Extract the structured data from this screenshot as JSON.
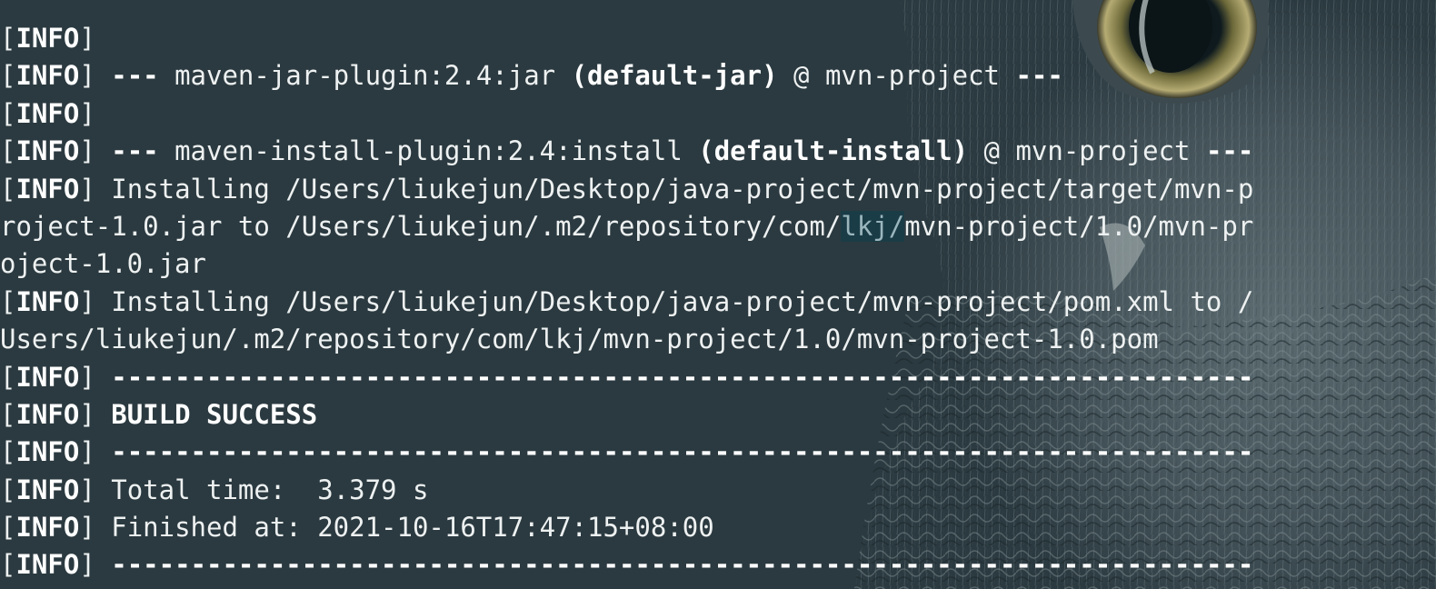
{
  "colors": {
    "background": "#2b3a40",
    "text": "#eef1f1",
    "bold_text": "#ffffff",
    "selection": "#1a3c47"
  },
  "background_image": "owl-wallpaper",
  "lines": [
    {
      "parts": [
        {
          "t": "[",
          "b": false
        },
        {
          "t": "INFO",
          "b": true
        },
        {
          "t": "]",
          "b": false
        }
      ]
    },
    {
      "parts": [
        {
          "t": "[",
          "b": false
        },
        {
          "t": "INFO",
          "b": true
        },
        {
          "t": "] ",
          "b": false
        },
        {
          "t": "---",
          "b": true
        },
        {
          "t": " maven-jar-plugin:2.4:jar ",
          "b": false
        },
        {
          "t": "(default-jar)",
          "b": true
        },
        {
          "t": " @ mvn-project ",
          "b": false
        },
        {
          "t": "---",
          "b": true
        }
      ]
    },
    {
      "parts": [
        {
          "t": "[",
          "b": false
        },
        {
          "t": "INFO",
          "b": true
        },
        {
          "t": "]",
          "b": false
        }
      ]
    },
    {
      "parts": [
        {
          "t": "[",
          "b": false
        },
        {
          "t": "INFO",
          "b": true
        },
        {
          "t": "] ",
          "b": false
        },
        {
          "t": "---",
          "b": true
        },
        {
          "t": " maven-install-plugin:2.4:install ",
          "b": false
        },
        {
          "t": "(default-install)",
          "b": true
        },
        {
          "t": " @ mvn-project ",
          "b": false
        },
        {
          "t": "---",
          "b": true
        }
      ]
    },
    {
      "parts": [
        {
          "t": "[",
          "b": false
        },
        {
          "t": "INFO",
          "b": true
        },
        {
          "t": "] Installing /Users/liukejun/Desktop/java-project/mvn-project/target/mvn-p",
          "b": false
        }
      ]
    },
    {
      "parts": [
        {
          "t": "roject-1.0.jar to /Users/liukejun/.m2/repository/com/",
          "b": false
        },
        {
          "t": "lkj/",
          "b": false,
          "hl": true
        },
        {
          "t": "mvn-project/1.0/mvn-pr",
          "b": false
        }
      ]
    },
    {
      "parts": [
        {
          "t": "oject-1.0.jar",
          "b": false
        }
      ]
    },
    {
      "parts": [
        {
          "t": "[",
          "b": false
        },
        {
          "t": "INFO",
          "b": true
        },
        {
          "t": "] Installing /Users/liukejun/Desktop/java-project/mvn-project/pom.xml to /",
          "b": false
        }
      ]
    },
    {
      "parts": [
        {
          "t": "Users/liukejun/.m2/repository/com/lkj/mvn-project/1.0/mvn-project-1.0.pom",
          "b": false
        }
      ]
    },
    {
      "parts": [
        {
          "t": "[",
          "b": false
        },
        {
          "t": "INFO",
          "b": true
        },
        {
          "t": "] ",
          "b": false
        },
        {
          "t": "------------------------------------------------------------------------",
          "b": true
        }
      ]
    },
    {
      "parts": [
        {
          "t": "[",
          "b": false
        },
        {
          "t": "INFO",
          "b": true
        },
        {
          "t": "] ",
          "b": false
        },
        {
          "t": "BUILD SUCCESS",
          "b": true
        }
      ]
    },
    {
      "parts": [
        {
          "t": "[",
          "b": false
        },
        {
          "t": "INFO",
          "b": true
        },
        {
          "t": "] ",
          "b": false
        },
        {
          "t": "------------------------------------------------------------------------",
          "b": true
        }
      ]
    },
    {
      "parts": [
        {
          "t": "[",
          "b": false
        },
        {
          "t": "INFO",
          "b": true
        },
        {
          "t": "] Total time:  3.379 s",
          "b": false
        }
      ]
    },
    {
      "parts": [
        {
          "t": "[",
          "b": false
        },
        {
          "t": "INFO",
          "b": true
        },
        {
          "t": "] Finished at: 2021-10-16T17:47:15+08:00",
          "b": false
        }
      ]
    },
    {
      "parts": [
        {
          "t": "[",
          "b": false
        },
        {
          "t": "INFO",
          "b": true
        },
        {
          "t": "] ",
          "b": false
        },
        {
          "t": "------------------------------------------------------------------------",
          "b": true
        }
      ]
    }
  ]
}
